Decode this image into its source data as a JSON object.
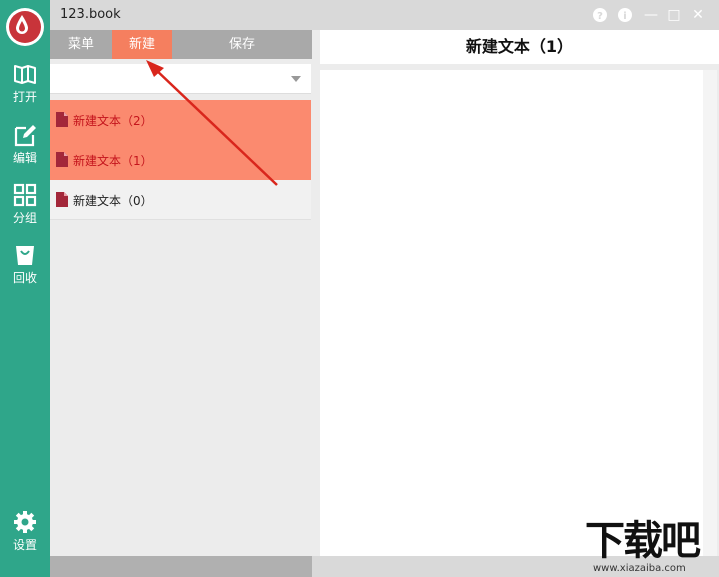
{
  "window": {
    "title": "123.book",
    "buttons": {
      "help": "?",
      "info": "i",
      "minimize": "—",
      "maximize": "□",
      "close": "✕"
    }
  },
  "sidebar": {
    "items": [
      {
        "label": "打开",
        "icon": "open-book-icon"
      },
      {
        "label": "编辑",
        "icon": "edit-icon"
      },
      {
        "label": "分组",
        "icon": "grid-icon"
      },
      {
        "label": "回收",
        "icon": "recycle-bag-icon"
      },
      {
        "label": "设置",
        "icon": "gear-icon"
      }
    ],
    "logo_icon": "droplet-logo-icon"
  },
  "tabs": {
    "menu": "菜单",
    "new": "新建",
    "save": "保存"
  },
  "group_select": {
    "value": ""
  },
  "documents": [
    {
      "name": "新建文本（2）",
      "selected": true
    },
    {
      "name": "新建文本（1）",
      "selected": true
    },
    {
      "name": "新建文本（0）",
      "selected": false
    }
  ],
  "editor": {
    "title": "新建文本（1）",
    "content": ""
  },
  "watermark": {
    "text": "下载吧",
    "url": "www.xiazaiba.com"
  },
  "colors": {
    "sidebar": "#2fa68a",
    "accent": "#f57f5f",
    "selected_row": "#fb8a6f",
    "selected_text": "#c4141c",
    "logo": "#c8343a"
  }
}
